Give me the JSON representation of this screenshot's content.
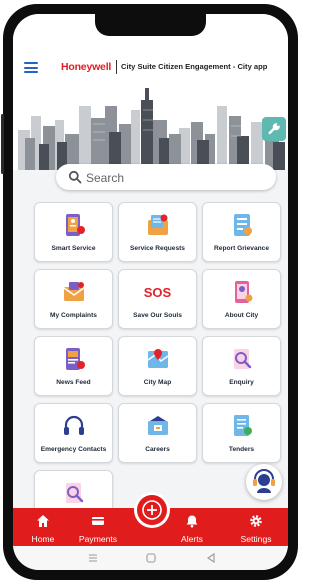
{
  "header": {
    "brand": "Honeywell",
    "app_title": "City Suite Citizen Engagement - City app"
  },
  "search": {
    "placeholder": "Search"
  },
  "tiles": [
    {
      "label": "Smart Service"
    },
    {
      "label": "Service Requests"
    },
    {
      "label": "Report Grievance"
    },
    {
      "label": "My Complaints"
    },
    {
      "label": "Save Our Souls",
      "badge_text": "SOS"
    },
    {
      "label": "About City"
    },
    {
      "label": "News Feed"
    },
    {
      "label": "City Map"
    },
    {
      "label": "Enquiry"
    },
    {
      "label": "Emergency Contacts"
    },
    {
      "label": "Careers"
    },
    {
      "label": "Tenders"
    }
  ],
  "bottom_nav": [
    {
      "label": "Home",
      "icon": "home-icon"
    },
    {
      "label": "Payments",
      "icon": "card-icon"
    },
    {
      "label": "Alerts",
      "icon": "bell-icon"
    },
    {
      "label": "Settings",
      "icon": "gear-icon"
    }
  ],
  "colors": {
    "brand_red": "#e01c1c",
    "accent_blue": "#2563c9",
    "tool_teal": "#5fb9b0"
  }
}
